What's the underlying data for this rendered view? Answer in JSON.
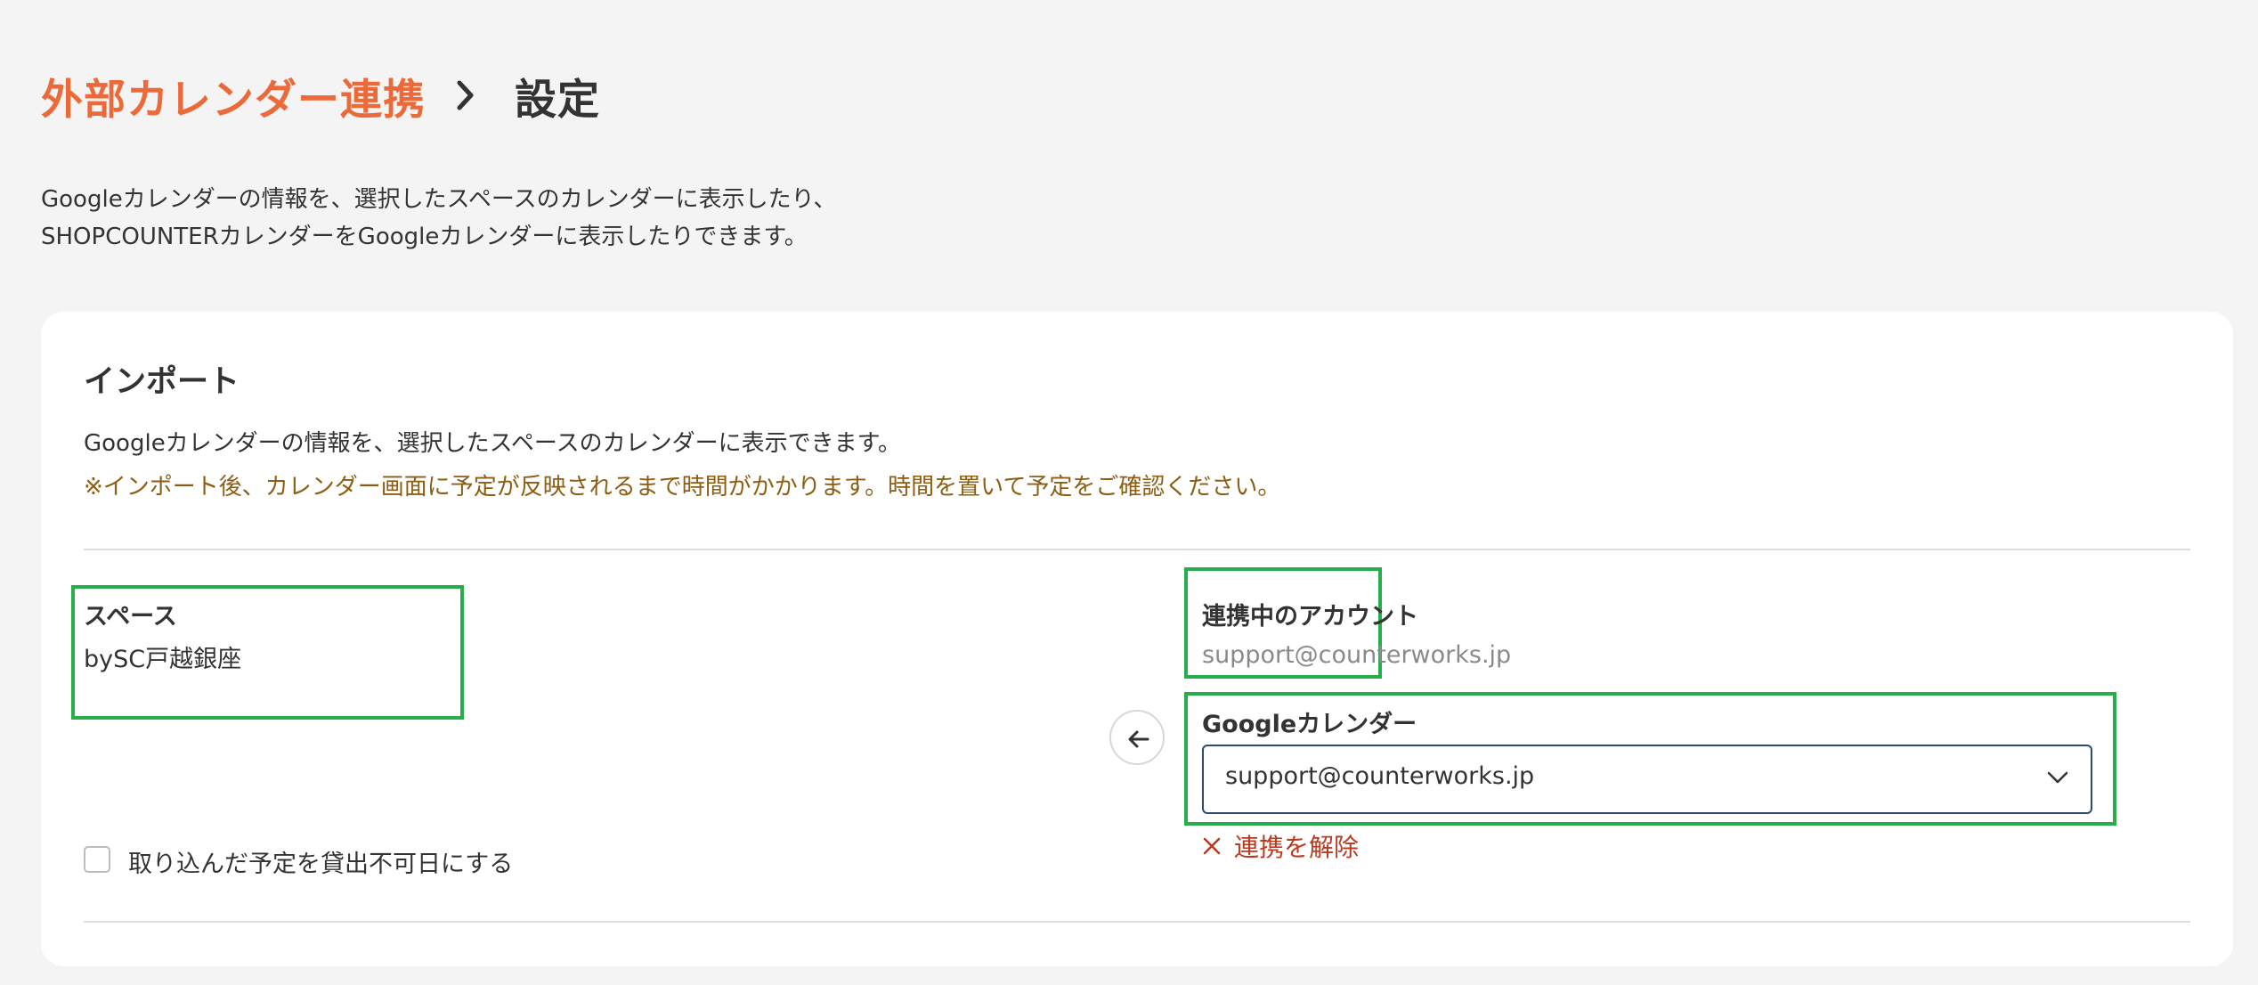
{
  "breadcrumb": {
    "parent": "外部カレンダー連携",
    "current": "設定"
  },
  "intro": {
    "line1": "Googleカレンダーの情報を、選択したスペースのカレンダーに表示したり、",
    "line2": "SHOPCOUNTERカレンダーをGoogleカレンダーに表示したりできます。"
  },
  "import": {
    "title": "インポート",
    "description": "Googleカレンダーの情報を、選択したスペースのカレンダーに表示できます。",
    "note": "※インポート後、カレンダー画面に予定が反映されるまで時間がかかります。時間を置いて予定をご確認ください。",
    "space": {
      "label": "スペース",
      "value": "bySC戸越銀座"
    },
    "account": {
      "label": "連携中のアカウント",
      "value": "support@counterworks.jp"
    },
    "google_calendar": {
      "label": "Googleカレンダー",
      "selected": "support@counterworks.jp"
    },
    "unlink_label": "連携を解除",
    "checkbox_label": "取り込んだ予定を貸出不可日にする",
    "checkbox_checked": false
  },
  "colors": {
    "accent": "#ec6a39",
    "note": "#8e5d12",
    "highlight": "#27ae4a",
    "danger": "#b93a1f"
  },
  "icons": {
    "breadcrumb_separator": "chevron-right-icon",
    "direction": "arrow-left-icon",
    "select": "chevron-down-icon",
    "unlink": "close-icon"
  }
}
